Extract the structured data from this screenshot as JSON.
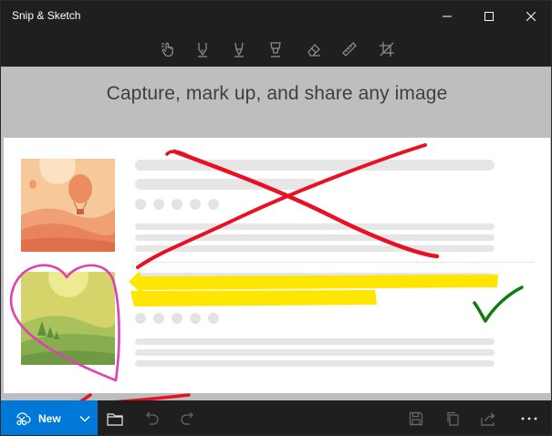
{
  "window": {
    "title": "Snip & Sketch"
  },
  "toolbar": {
    "tools": [
      {
        "name": "touch-writing",
        "icon": "touch-writing-icon"
      },
      {
        "name": "ballpoint-pen",
        "icon": "ballpoint-pen-icon"
      },
      {
        "name": "pencil",
        "icon": "pencil-icon"
      },
      {
        "name": "highlighter",
        "icon": "highlighter-icon"
      },
      {
        "name": "eraser",
        "icon": "eraser-icon"
      },
      {
        "name": "ruler",
        "icon": "ruler-icon"
      },
      {
        "name": "crop",
        "icon": "crop-icon"
      }
    ]
  },
  "content": {
    "tagline": "Capture, mark up, and share any image"
  },
  "commandbar": {
    "new_label": "New",
    "actions": [
      {
        "name": "open-file",
        "icon": "folder-icon",
        "enabled": true
      },
      {
        "name": "undo",
        "icon": "undo-icon",
        "enabled": false
      },
      {
        "name": "redo",
        "icon": "redo-icon",
        "enabled": false
      },
      {
        "name": "save",
        "icon": "save-icon",
        "enabled": false
      },
      {
        "name": "copy",
        "icon": "copy-icon",
        "enabled": false
      },
      {
        "name": "share",
        "icon": "share-icon",
        "enabled": false
      },
      {
        "name": "more",
        "icon": "more-icon",
        "enabled": true
      }
    ]
  },
  "colors": {
    "accent": "#0078d7",
    "frame": "#1f1f1f",
    "ink_red": "#e81123",
    "ink_green": "#107c10",
    "ink_pink": "#e040b0",
    "highlight_yellow": "#ffe600"
  }
}
